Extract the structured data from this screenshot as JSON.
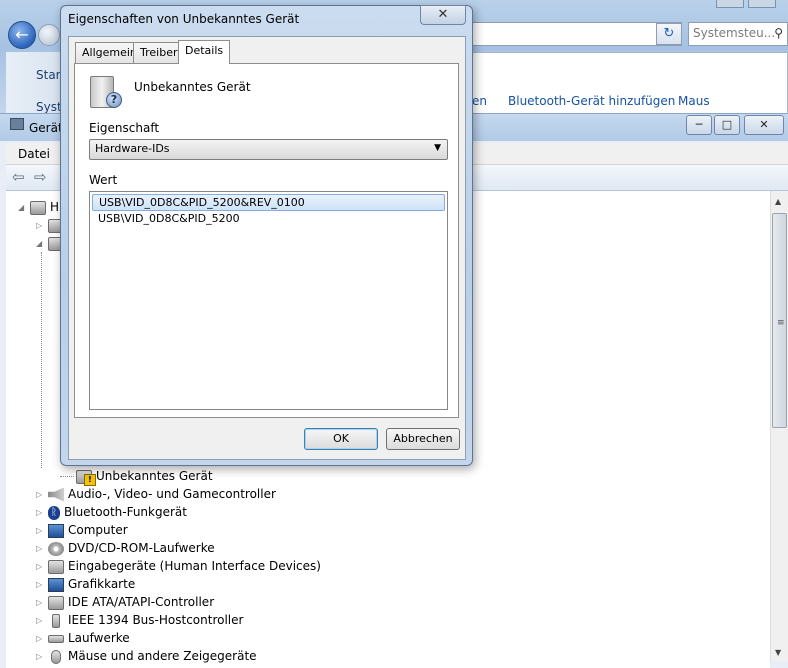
{
  "control_panel": {
    "search_placeholder": "Systemsteu...",
    "left_items": [
      "Start",
      "Syste"
    ],
    "links": [
      {
        "label": "en"
      },
      {
        "label": "Bluetooth-Gerät hinzufügen"
      },
      {
        "label": "Maus"
      }
    ]
  },
  "device_manager": {
    "title": "Geräte",
    "menu": [
      "Datei"
    ],
    "tree_partial_root": "H",
    "tree": [
      {
        "label": "Unbekanntes Gerät",
        "icon": "warning-device-icon"
      },
      {
        "label": "Audio-, Video- und Gamecontroller",
        "icon": "speaker-icon"
      },
      {
        "label": "Bluetooth-Funkgerät",
        "icon": "bluetooth-icon"
      },
      {
        "label": "Computer",
        "icon": "computer-icon"
      },
      {
        "label": "DVD/CD-ROM-Laufwerke",
        "icon": "disc-icon"
      },
      {
        "label": "Eingabegeräte (Human Interface Devices)",
        "icon": "hid-icon"
      },
      {
        "label": "Grafikkarte",
        "icon": "display-adapter-icon"
      },
      {
        "label": "IDE ATA/ATAPI-Controller",
        "icon": "ide-icon"
      },
      {
        "label": "IEEE 1394 Bus-Hostcontroller",
        "icon": "firewire-icon"
      },
      {
        "label": "Laufwerke",
        "icon": "drive-icon"
      },
      {
        "label": "Mäuse und andere Zeigegeräte",
        "icon": "mouse-icon"
      }
    ]
  },
  "dialog": {
    "title": "Eigenschaften von Unbekanntes Gerät",
    "close_glyph": "✕",
    "tabs": [
      {
        "label": "Allgemein",
        "active": false
      },
      {
        "label": "Treiber",
        "active": false
      },
      {
        "label": "Details",
        "active": true
      }
    ],
    "device_name": "Unbekanntes Gerät",
    "property_label": "Eigenschaft",
    "property_selected": "Hardware-IDs",
    "value_label": "Wert",
    "values": [
      "USB\\VID_0D8C&PID_5200&REV_0100",
      "USB\\VID_0D8C&PID_5200"
    ],
    "selected_index": 0,
    "ok_label": "OK",
    "cancel_label": "Abbrechen"
  }
}
